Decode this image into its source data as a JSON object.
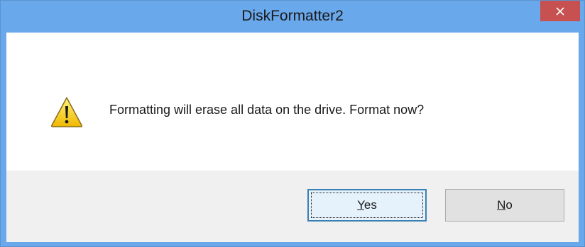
{
  "window": {
    "title": "DiskFormatter2"
  },
  "dialog": {
    "icon": "warning-icon",
    "message": "Formatting will erase all data on the drive. Format now?"
  },
  "buttons": {
    "yes": {
      "mnemonic": "Y",
      "rest": "es"
    },
    "no": {
      "mnemonic": "N",
      "rest": "o"
    }
  },
  "colors": {
    "titlebar": "#6aa8ec",
    "close_button": "#c75050",
    "footer": "#f0f0f0",
    "default_button_border": "#3c7fb1"
  }
}
